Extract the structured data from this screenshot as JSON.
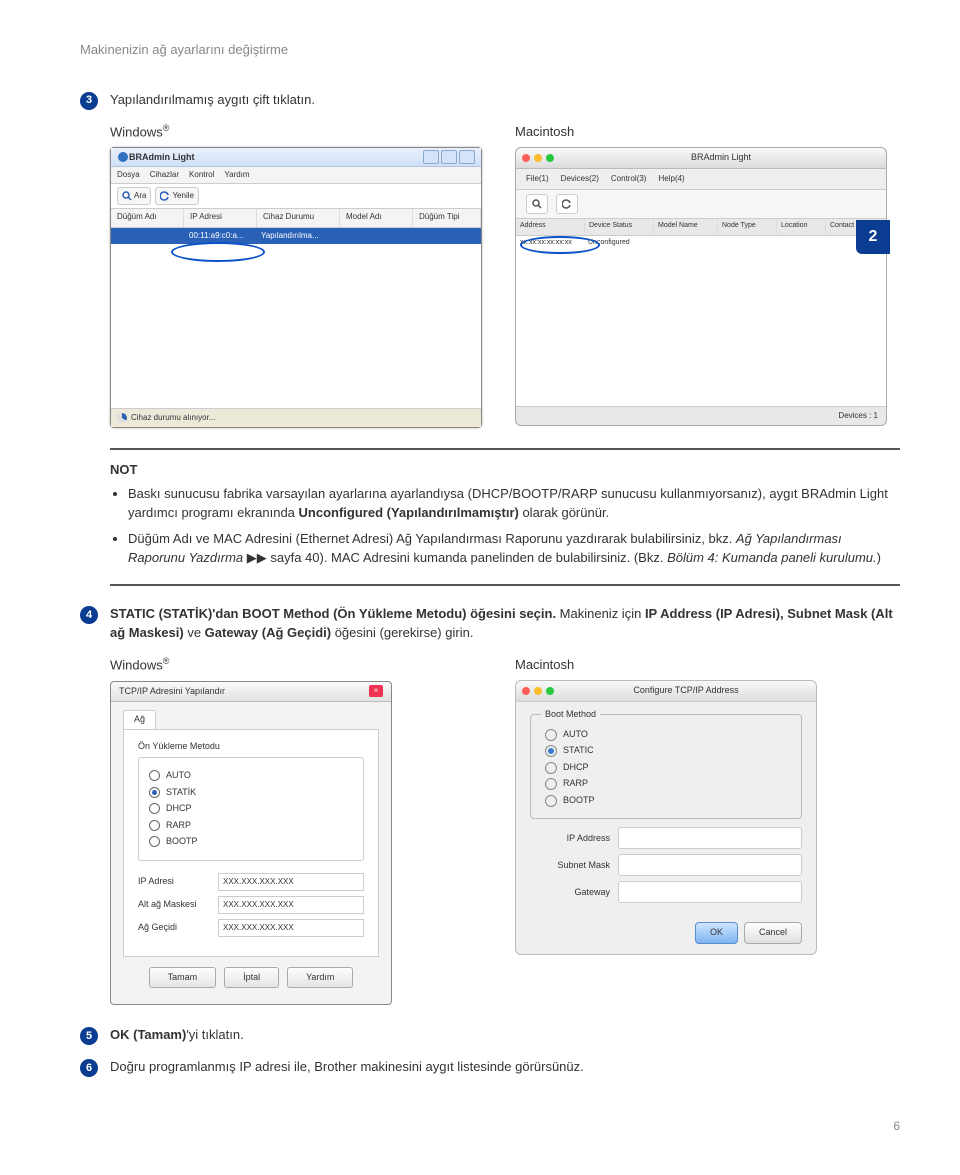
{
  "header": "Makinenizin ağ ayarlarını değiştirme",
  "sideMarker": "2",
  "steps": {
    "s3": "Yapılandırılmamış aygıtı çift tıklatın.",
    "s4a": "STATIC (STATİK)'dan BOOT Method (Ön Yükleme Metodu) öğesini seçin.",
    "s4b": " Makineniz için ",
    "s4c": "IP Address (IP Adresi), Subnet Mask (Alt ağ Maskesi)",
    "s4d": " ve ",
    "s4e": "Gateway (Ağ Geçidi)",
    "s4f": " öğesini (gerekirse) girin.",
    "s5a": "OK (Tamam)",
    "s5b": "'yi tıklatın.",
    "s6": "Doğru programlanmış IP adresi ile, Brother makinesini aygıt listesinde görürsünüz."
  },
  "labels": {
    "windows": "Windows",
    "macintosh": "Macintosh",
    "reg": "®"
  },
  "note": {
    "title": "NOT",
    "b1a": "Baskı sunucusu fabrika varsayılan ayarlarına ayarlandıysa (DHCP/BOOTP/RARP sunucusu kullanmıyorsanız), aygıt BRAdmin Light yardımcı programı ekranında ",
    "b1b": "Unconfigured (Yapılandırılmamıştır)",
    "b1c": " olarak görünür.",
    "b2a": "Düğüm Adı ve MAC Adresini (Ethernet Adresi) Ağ Yapılandırması Raporunu yazdırarak bulabilirsiniz, bkz. ",
    "b2b": "Ağ Yapılandırması Raporunu Yazdırma",
    "b2c": " ▶▶ sayfa 40). MAC Adresini kumanda panelinden de bulabilirsiniz. (Bkz. ",
    "b2d": "Bölüm 4: Kumanda paneli kurulumu.",
    "b2e": ")"
  },
  "winApp": {
    "title": "BRAdmin Light",
    "menu": [
      "Dosya",
      "Cihazlar",
      "Kontrol",
      "Yardım"
    ],
    "tools": [
      "Ara",
      "Yenile"
    ],
    "cols": [
      "Düğüm Adı",
      "IP Adresi",
      "Cihaz Durumu",
      "Model Adı",
      "Düğüm Tipi"
    ],
    "mac": "00:11:a9:c0:a...",
    "conf": "Yapılandırılma...",
    "status": "Cihaz durumu alınıyor..."
  },
  "macApp": {
    "title": "BRAdmin Light",
    "tabs": [
      "File(1)",
      "Devices(2)",
      "Control(3)",
      "Help(4)"
    ],
    "cols": [
      "Address",
      "Device Status",
      "Model Name",
      "Node Type",
      "Location",
      "Contact"
    ],
    "mac": "xx:xx:xx:xx:xx:xx",
    "conf": "Unconfigured",
    "devices": "Devices : 1"
  },
  "tcpWin": {
    "title": "TCP/IP Adresini Yapılandır",
    "tab": "Ağ",
    "group": "Ön Yükleme Metodu",
    "opts": [
      "AUTO",
      "STATİK",
      "DHCP",
      "RARP",
      "BOOTP"
    ],
    "selected": 1,
    "fields": [
      "IP Adresi",
      "Alt ağ Maskesi",
      "Ağ Geçidi"
    ],
    "placeholder": "XXX.XXX.XXX.XXX",
    "btns": [
      "Tamam",
      "İptal",
      "Yardım"
    ]
  },
  "tcpMac": {
    "title": "Configure TCP/IP Address",
    "group": "Boot Method",
    "opts": [
      "AUTO",
      "STATIC",
      "DHCP",
      "RARP",
      "BOOTP"
    ],
    "selected": 1,
    "fields": [
      "IP Address",
      "Subnet Mask",
      "Gateway"
    ],
    "btns": [
      "OK",
      "Cancel"
    ]
  },
  "pageNum": "6"
}
